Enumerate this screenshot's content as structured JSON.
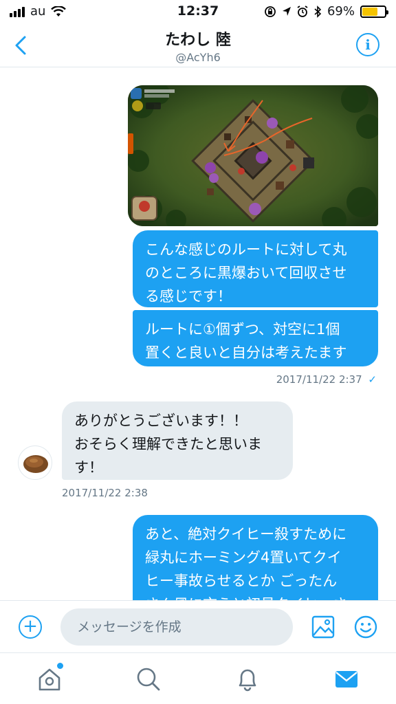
{
  "status_bar": {
    "carrier": "au",
    "time": "12:37",
    "battery": "69%",
    "battery_level": 0.69
  },
  "header": {
    "title": "たわし 陸",
    "handle": "@AcYh6",
    "back_icon": "chevron-left-icon",
    "info_icon": "info-icon",
    "info_label": "i"
  },
  "messages": [
    {
      "direction": "outgoing",
      "type": "image",
      "image_desc": "game-screenshot"
    },
    {
      "direction": "outgoing",
      "lines": [
        "こんな感じのルートに対して丸",
        "のところに黒爆おいて回収させ",
        "る感じです！"
      ]
    },
    {
      "direction": "outgoing",
      "lines": [
        "ルートに①個ずつ、対空に1個",
        "置くと良いと自分は考えたます"
      ]
    },
    {
      "direction": "incoming",
      "lines": [
        "ありがとうございます！！",
        "おそらく理解できたと思いま",
        "す！"
      ]
    },
    {
      "direction": "outgoing",
      "lines": [
        "あと、絶対クイヒー殺すために",
        "緑丸にホーミング4置いてクイ",
        "ヒー事故らせるとか ごったん",
        "さん風に言うと初見クイヒーさ"
      ]
    }
  ],
  "timestamps": {
    "outgoing": "2017/11/22 2:37",
    "outgoing_check": "✓",
    "incoming": "2017/11/22 2:38"
  },
  "composer": {
    "placeholder": "メッセージを作成",
    "add_label": "+"
  },
  "tabs": [
    "home",
    "search",
    "notifications",
    "messages"
  ],
  "colors": {
    "accent": "#1da1f2",
    "incoming_bubble": "#e6ecf0",
    "secondary_text": "#657786"
  }
}
